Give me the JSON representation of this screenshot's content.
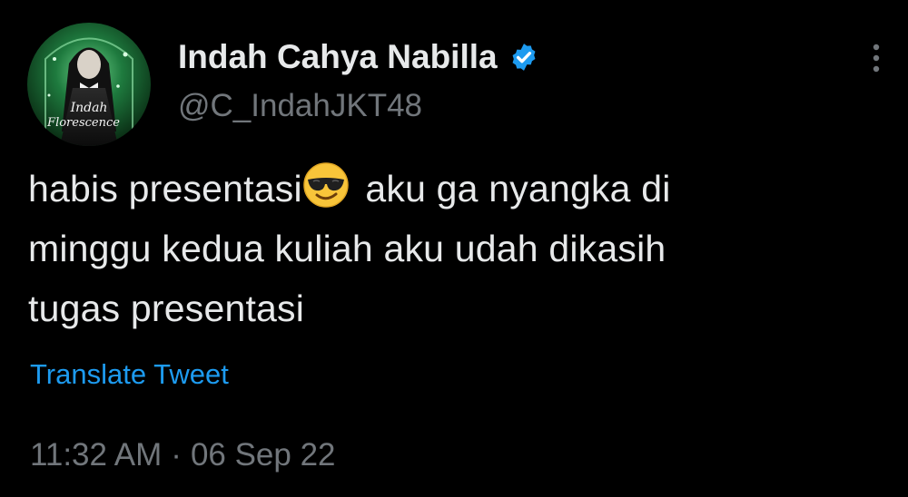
{
  "author": {
    "display_name": "Indah Cahya Nabilla",
    "handle": "@C_IndahJKT48",
    "avatar_caption_top": "Indah",
    "avatar_caption_bottom": "Florescence",
    "verified": true
  },
  "tweet": {
    "line1_before_emoji": "habis presentasi",
    "emoji": "smiling-face-with-sunglasses",
    "line1_after_emoji": " aku ga nyangka di",
    "line2": "minggu kedua kuliah aku udah dikasih",
    "line3": "tugas presentasi"
  },
  "actions": {
    "translate_label": "Translate Tweet",
    "more_icon": "more-vertical-icon"
  },
  "meta": {
    "time": "11:32 AM",
    "separator": "·",
    "date": "06 Sep 22"
  },
  "colors": {
    "background": "#000000",
    "primary_text": "#e7e9ea",
    "secondary_text": "#71767b",
    "link": "#1d9bf0",
    "verified_badge": "#1d9bf0"
  }
}
